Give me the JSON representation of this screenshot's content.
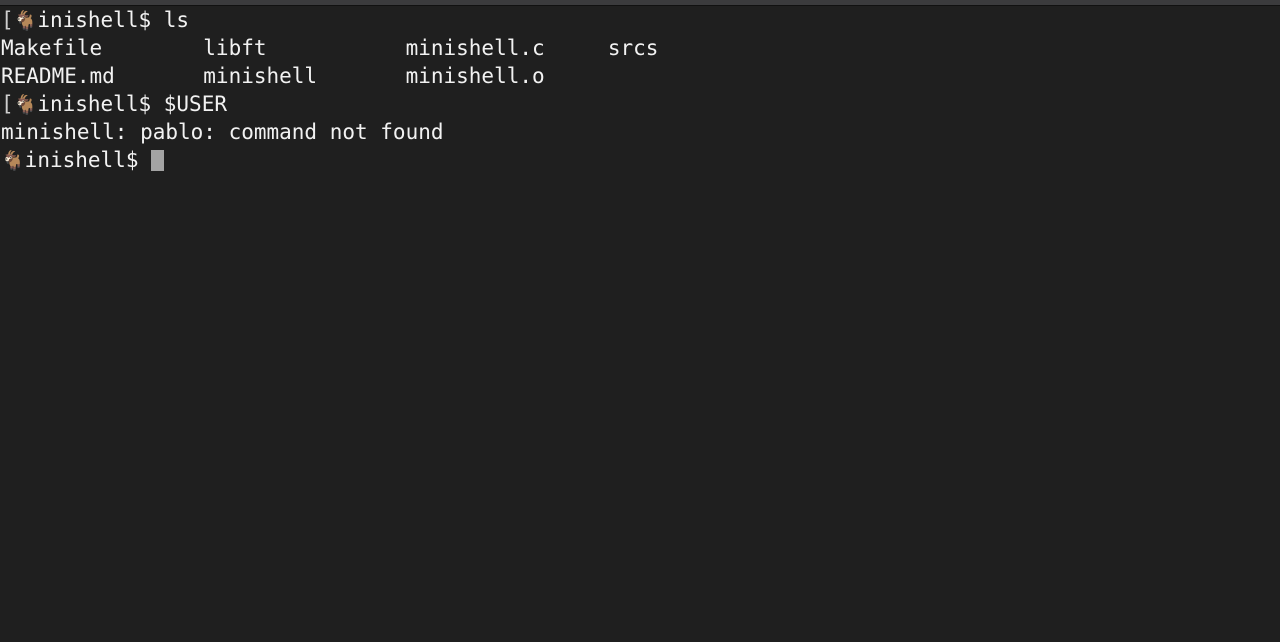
{
  "window": {
    "chrome_color": "#3b3b3d",
    "background_color": "#1f1f1f",
    "foreground_color": "#f2f2f2",
    "cursor_color": "#a3a3a3"
  },
  "terminal": {
    "prompt": {
      "bracket": "[",
      "goat_icon": "🐐",
      "text": "inishell$ "
    },
    "lines": [
      {
        "type": "prompt",
        "bracket": "[",
        "goat": "🐐",
        "prompt_text": "inishell$ ",
        "command": "ls"
      },
      {
        "type": "output",
        "columns": [
          "Makefile",
          "libft",
          "minishell.c",
          "srcs"
        ],
        "text": "Makefile        libft           minishell.c     srcs"
      },
      {
        "type": "output",
        "columns": [
          "README.md",
          "minishell",
          "minishell.o"
        ],
        "text": "README.md       minishell       minishell.o"
      },
      {
        "type": "prompt",
        "bracket": "[",
        "goat": "🐐",
        "prompt_text": "inishell$ ",
        "command": "$USER"
      },
      {
        "type": "output",
        "text": "minishell: pablo: command not found"
      },
      {
        "type": "prompt",
        "bracket": "",
        "goat": "🐐",
        "prompt_text": "inishell$ ",
        "command": "",
        "cursor": true
      }
    ]
  }
}
